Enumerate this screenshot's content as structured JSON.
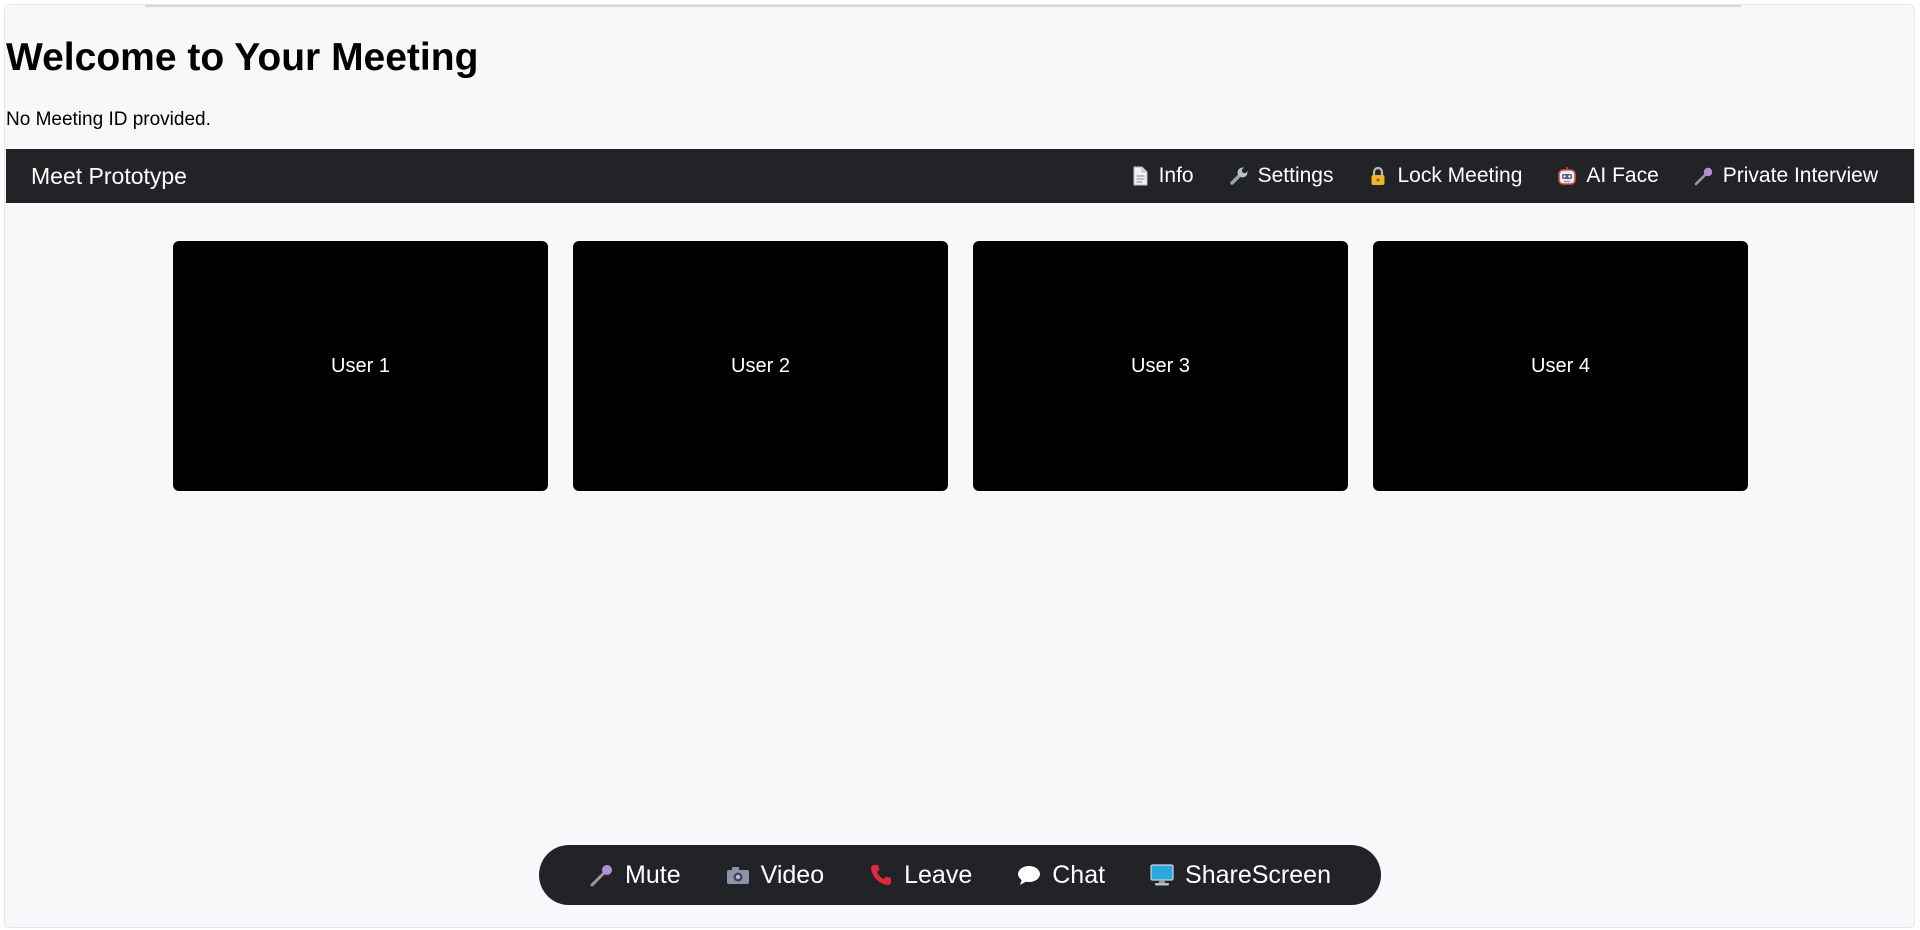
{
  "page": {
    "title": "Welcome to Your Meeting",
    "meeting_id_text": "No Meeting ID provided."
  },
  "navbar": {
    "brand": "Meet Prototype",
    "items": [
      {
        "label": "Info",
        "icon": "document-icon"
      },
      {
        "label": "Settings",
        "icon": "wrench-icon"
      },
      {
        "label": "Lock Meeting",
        "icon": "lock-icon"
      },
      {
        "label": "AI Face",
        "icon": "robot-icon"
      },
      {
        "label": "Private Interview",
        "icon": "microphone-icon"
      }
    ]
  },
  "video_tiles": [
    {
      "label": "User 1"
    },
    {
      "label": "User 2"
    },
    {
      "label": "User 3"
    },
    {
      "label": "User 4"
    }
  ],
  "controls": [
    {
      "label": "Mute",
      "icon": "microphone-icon"
    },
    {
      "label": "Video",
      "icon": "camera-icon"
    },
    {
      "label": "Leave",
      "icon": "phone-icon"
    },
    {
      "label": "Chat",
      "icon": "speech-bubble-icon"
    },
    {
      "label": "ShareScreen",
      "icon": "monitor-icon"
    }
  ],
  "colors": {
    "navbar_bg": "#212326",
    "page_bg": "#f7f8fa",
    "tile_bg": "#000000",
    "leave_red": "#e02a3a",
    "lock_gold": "#f2b42a",
    "monitor_blue": "#2aa8e0"
  }
}
